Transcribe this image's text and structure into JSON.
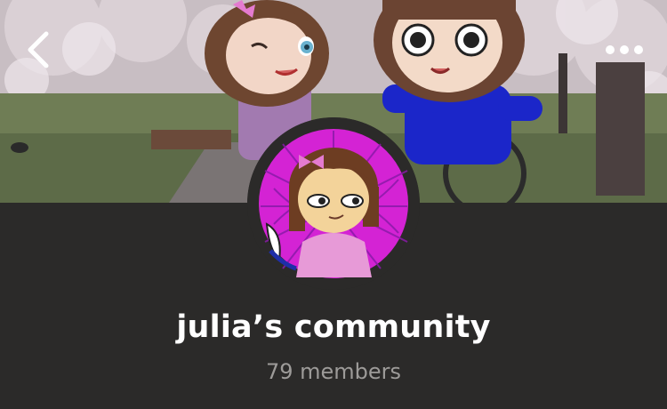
{
  "community": {
    "name": "julia’s community",
    "members_label": "79 members"
  },
  "nav": {
    "back_icon": "chevron-left-icon",
    "menu_icon": "more-horizontal-icon"
  },
  "colors": {
    "panel_bg": "#2b2a29",
    "title_text": "#ffffff",
    "members_text": "#9d9b99",
    "avatar_bg": "#d423d4"
  }
}
